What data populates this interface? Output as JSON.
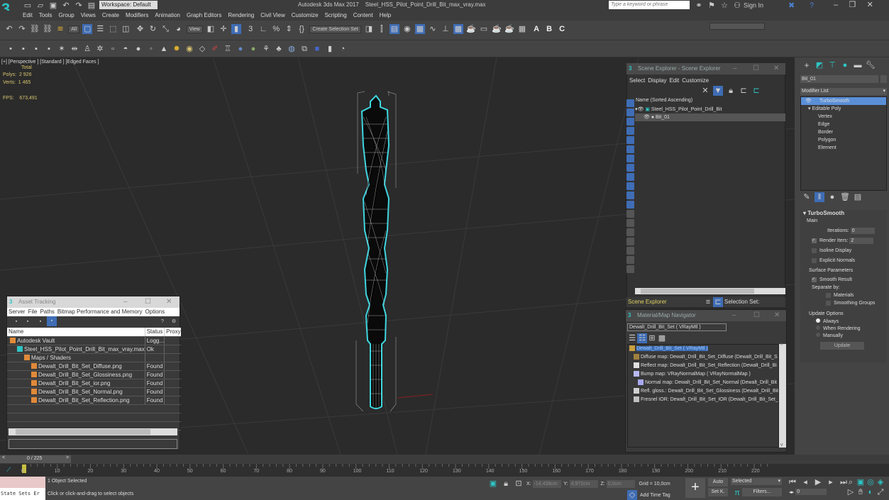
{
  "app": {
    "title": "Autodesk 3ds Max 2017",
    "file": "Steel_HSS_Pilot_Point_Drill_Bit_max_vray.max",
    "workspace": "Workspace: Default",
    "search_placeholder": "Type a keyword or phrase",
    "sign_in": "Sign In"
  },
  "menu": [
    "Edit",
    "Tools",
    "Group",
    "Views",
    "Create",
    "Modifiers",
    "Animation",
    "Graph Editors",
    "Rendering",
    "Civil View",
    "Customize",
    "Scripting",
    "Content",
    "Help"
  ],
  "toolbar": {
    "selection_filter": "All",
    "reference_coord": "View",
    "create_selection_set": "Create Selection Set"
  },
  "viewport": {
    "label": "[+] [Perspective ] [Standard ] [Edged Faces ]",
    "stats_header": "Total",
    "polys_label": "Polys:",
    "polys_value": "2 926",
    "verts_label": "Verts:",
    "verts_value": "1 465",
    "fps_label": "FPS:",
    "fps_value": "673,491",
    "wire_color": "#3fd6e0"
  },
  "scene_explorer": {
    "title": "Scene Explorer - Scene Explorer",
    "menu": [
      "Select",
      "Display",
      "Edit",
      "Customize"
    ],
    "column": "Name (Sorted Ascending)",
    "items": [
      {
        "label": "Steel_HSS_Pilot_Point_Drill_Bit",
        "level": 0
      },
      {
        "label": "Bit_01",
        "level": 1,
        "selected": true
      }
    ],
    "footer_label": "Scene Explorer",
    "selection_set_label": "Selection Set:"
  },
  "material_navigator": {
    "title": "Material/Map Navigator",
    "current": "Dewalt_Drill_Bit_Set  ( VRayMtl )",
    "items": [
      {
        "label": "Dewalt_Drill_Bit_Set  ( VRayMtl )",
        "selected": true,
        "swatch": "#c8a040"
      },
      {
        "label": "Diffuse map: Dewalt_Drill_Bit_Set_Diffuse (Dewalt_Drill_Bit_S",
        "swatch": "#a08040"
      },
      {
        "label": "Reflect map: Dewalt_Drill_Bit_Set_Reflection (Dewalt_Drill_Bi",
        "swatch": "#e0e0e0"
      },
      {
        "label": "Bump map: VRayNormalMap  ( VRayNormalMap )",
        "swatch": "#b8b8f0"
      },
      {
        "label": "Normal map: Dewalt_Drill_Bit_Set_Normal (Dewalt_Drill_Bit",
        "swatch": "#a8a8f0"
      },
      {
        "label": "Refl. gloss.: Dewalt_Drill_Bit_Set_Glossiness (Dewalt_Drill_Bit",
        "swatch": "#d0d0d0"
      },
      {
        "label": "Fresnel IOR: Dewalt_Drill_Bit_Set_IOR (Dewalt_Drill_Bit_Set_",
        "swatch": "#c0c0c0"
      }
    ]
  },
  "asset_tracking": {
    "title": "Asset Tracking",
    "menu": [
      "Server",
      "File",
      "Paths",
      "Bitmap Performance and Memory",
      "Options"
    ],
    "columns": [
      "Name",
      "Status",
      "Proxy"
    ],
    "rows": [
      {
        "name": "Autodesk Vault",
        "status": "Logg...",
        "indent": 0
      },
      {
        "name": "Steel_HSS_Pilot_Point_Drill_Bit_max_vray.max",
        "status": "Ok",
        "indent": 1
      },
      {
        "name": "Maps / Shaders",
        "status": "",
        "indent": 2
      },
      {
        "name": "Dewalt_Drill_Bit_Set_Diffuse.png",
        "status": "Found",
        "indent": 3
      },
      {
        "name": "Dewalt_Drill_Bit_Set_Glossiness.png",
        "status": "Found",
        "indent": 3
      },
      {
        "name": "Dewalt_Drill_Bit_Set_ior.png",
        "status": "Found",
        "indent": 3
      },
      {
        "name": "Dewalt_Drill_Bit_Set_Normal.png",
        "status": "Found",
        "indent": 3
      },
      {
        "name": "Dewalt_Drill_Bit_Set_Reflection.png",
        "status": "Found",
        "indent": 3
      }
    ]
  },
  "command_panel": {
    "object_name": "Bit_01",
    "modifier_list": "Modifier List",
    "stack": [
      {
        "label": "TurboSmooth",
        "selected": true
      },
      {
        "label": "Editable Poly",
        "selected": false
      },
      {
        "label": "Vertex"
      },
      {
        "label": "Edge"
      },
      {
        "label": "Border"
      },
      {
        "label": "Polygon"
      },
      {
        "label": "Element"
      }
    ],
    "turbosmooth": {
      "title": "TurboSmooth",
      "main": "Main",
      "iterations_label": "Iterations:",
      "iterations_value": "0",
      "render_iters_label": "Render Iters:",
      "render_iters_value": "2",
      "render_iters_checked": true,
      "isoline_display": "Isoline Display",
      "explicit_normals": "Explicit Normals",
      "surface_params": "Surface Parameters",
      "smooth_result": "Smooth Result",
      "separate_by": "Separate by:",
      "materials": "Materials",
      "smoothing_groups": "Smoothing Groups",
      "update_options": "Update Options",
      "always": "Always",
      "when_rendering": "When Rendering",
      "manually": "Manually",
      "update_button": "Update"
    }
  },
  "timeline": {
    "frame": "0 / 225",
    "current_frame": 0,
    "total_frames": 225,
    "ticks": [
      "0",
      "10",
      "20",
      "30",
      "40",
      "50",
      "60",
      "70",
      "80",
      "90",
      "100",
      "110",
      "120",
      "130",
      "140",
      "150",
      "160",
      "170",
      "180",
      "190",
      "200",
      "210",
      "220"
    ]
  },
  "status": {
    "state_sets": "State Sets Er",
    "selected": "1 Object Selected",
    "prompt": "Click or click-and-drag to select objects",
    "x_label": "X:",
    "x_value": "-14,438cm",
    "y_label": "Y:",
    "y_value": "4,972cm",
    "z_label": "Z:",
    "z_value": "0,0cm",
    "grid": "Grid = 10,0cm",
    "add_time_tag": "Add Time Tag",
    "auto": "Auto",
    "set_key": "Set K.",
    "key_mode": "Selected",
    "filters": "Filters...",
    "frame_value": "0"
  }
}
